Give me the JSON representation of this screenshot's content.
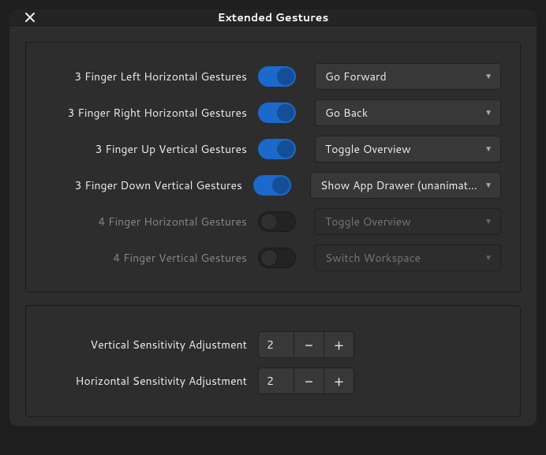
{
  "window": {
    "title": "Extended Gestures"
  },
  "gestures": [
    {
      "label": "3 Finger Left Horizontal Gestures",
      "enabled": true,
      "action": "Go Forward"
    },
    {
      "label": "3 Finger Right Horizontal Gestures",
      "enabled": true,
      "action": "Go Back"
    },
    {
      "label": "3 Finger Up Vertical Gestures",
      "enabled": true,
      "action": "Toggle Overview"
    },
    {
      "label": "3 Finger Down Vertical Gestures",
      "enabled": true,
      "action": "Show App Drawer (unanimated)"
    },
    {
      "label": "4 Finger Horizontal Gestures",
      "enabled": false,
      "action": "Toggle Overview"
    },
    {
      "label": "4 Finger Vertical Gestures",
      "enabled": false,
      "action": "Switch Workspace"
    }
  ],
  "sensitivity": {
    "vertical": {
      "label": "Vertical Sensitivity Adjustment",
      "value": "2"
    },
    "horizontal": {
      "label": "Horizontal Sensitivity Adjustment",
      "value": "2"
    }
  },
  "symbols": {
    "minus": "−",
    "plus": "+"
  }
}
